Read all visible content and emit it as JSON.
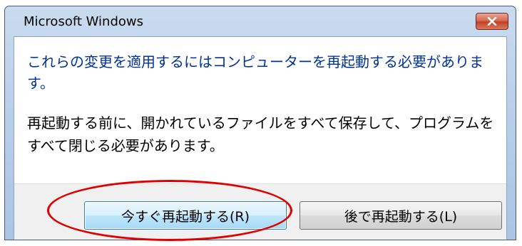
{
  "window": {
    "title": "Microsoft Windows",
    "close_icon": "close-icon"
  },
  "dialog": {
    "main_instruction": "これらの変更を適用するにはコンピューターを再起動する必要があります。",
    "content": "再起動する前に、開かれているファイルをすべて保存して、プログラムをすべて閉じる必要があります。"
  },
  "buttons": {
    "restart_now": "今すぐ再起動する(R)",
    "restart_later": "後で再起動する(L)"
  },
  "colors": {
    "instruction_text": "#003399",
    "highlight": "#e00000",
    "close_button": "#c14226"
  }
}
